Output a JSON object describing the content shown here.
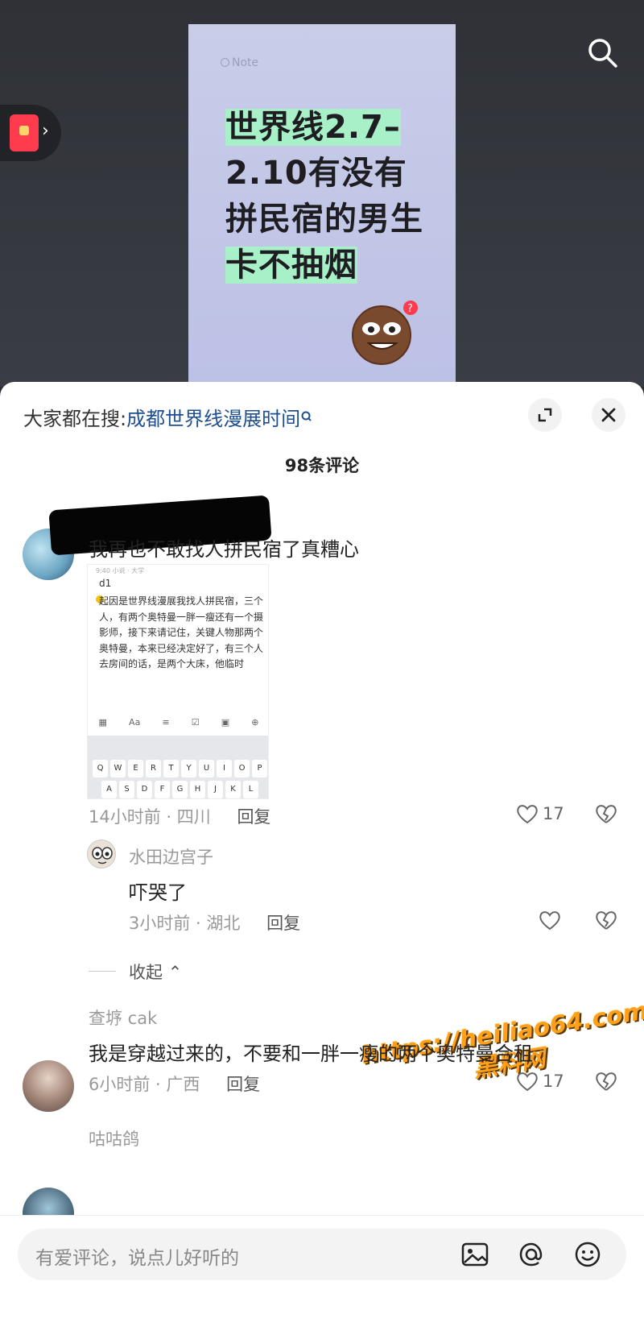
{
  "video": {
    "note_tag": "Note",
    "headline_lines": [
      "世界线2.7–",
      "2.10有没有",
      "拼民宿的男生",
      "卡不抽烟"
    ]
  },
  "sheet": {
    "trend_prefix": "大家都在搜:",
    "trend_query": "成都世界线漫展时间",
    "comment_count": "98条评论"
  },
  "comments": [
    {
      "text": "我再也不敢找人拼民宿了真糟心",
      "image": {
        "top_line": "9:40 小说 · 大学",
        "title": "d1",
        "body": "起因是世界线漫展我找人拼民宿，三个人，有两个奥特曼一胖一瘦还有一个摄影师，接下来请记住，关键人物那两个奥特曼，本来已经决定好了，有三个人去房间的话，是两个大床，他临时",
        "keyboard_row1": [
          "Q",
          "W",
          "E",
          "R",
          "T",
          "Y",
          "U",
          "I",
          "O",
          "P"
        ],
        "keyboard_row2": [
          "A",
          "S",
          "D",
          "F",
          "G",
          "H",
          "J",
          "K",
          "L"
        ]
      },
      "meta": "14小时前 · 四川",
      "reply": "回复",
      "likes": "17",
      "replies": [
        {
          "user": "水田边宫子",
          "text": "吓哭了",
          "meta": "3小时前 · 湖北",
          "reply": "回复"
        }
      ],
      "collapse": "收起"
    },
    {
      "user": "查垿 cak",
      "text": "我是穿越过来的，不要和一胖一瘦的两个奥特曼合租",
      "meta": "6小时前 · 广西",
      "reply": "回复",
      "likes": "17"
    },
    {
      "user": "咕咕鸽"
    }
  ],
  "watermark": {
    "line1": "https://heiliao64.com",
    "line2": "黑料网"
  },
  "input": {
    "placeholder": "有爱评论，说点儿好听的"
  }
}
